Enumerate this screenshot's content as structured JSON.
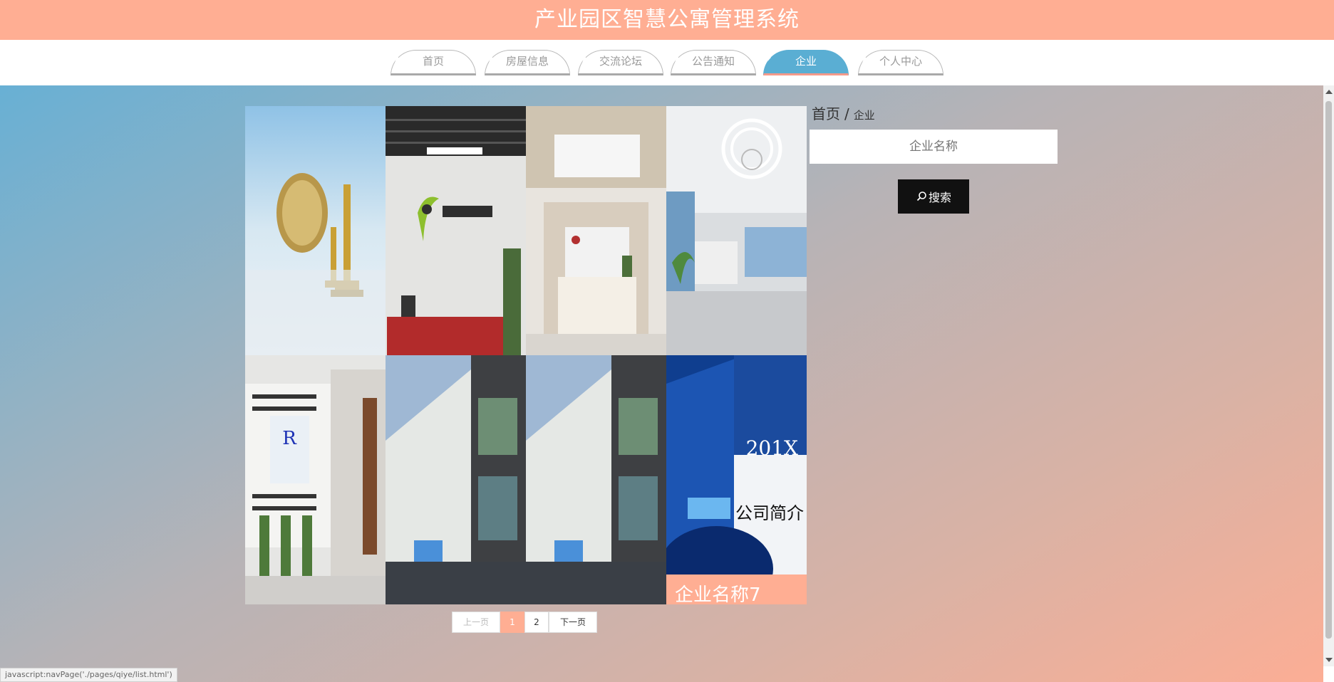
{
  "header": {
    "title": "产业园区智慧公寓管理系统"
  },
  "nav": {
    "items": [
      {
        "label": "首页"
      },
      {
        "label": "房屋信息"
      },
      {
        "label": "交流论坛"
      },
      {
        "label": "公告通知"
      },
      {
        "label": "企业"
      },
      {
        "label": "个人中心"
      }
    ],
    "active": "企业"
  },
  "breadcrumb": {
    "home": "首页",
    "sep": "/",
    "current": "企业"
  },
  "search": {
    "placeholder": "企业名称",
    "button_label": "搜索",
    "icon": "search-icon"
  },
  "tiles": [
    {
      "image": "chess-pieces-globe"
    },
    {
      "image": "office-reception-tianjiao"
    },
    {
      "image": "office-reception-wood"
    },
    {
      "image": "office-lobby-circular-light"
    },
    {
      "image": "office-hallway-plants"
    },
    {
      "image": "office-building-exterior"
    },
    {
      "image": "office-building-exterior"
    },
    {
      "image": "company-profile-cover",
      "caption": "企业名称7"
    }
  ],
  "pagination": {
    "prev": "上一页",
    "pages": [
      "1",
      "2"
    ],
    "current": "1",
    "next": "下一页"
  },
  "statusbar": {
    "text": "javascript:navPage('./pages/qiye/list.html')"
  },
  "colors": {
    "header_bg": "#FFAE93",
    "nav_active": "#5AAED3",
    "search_button": "#111111"
  }
}
